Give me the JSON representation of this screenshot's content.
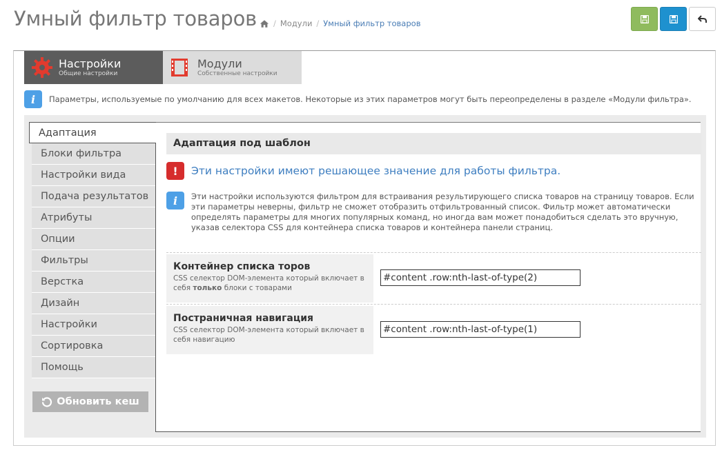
{
  "header": {
    "title": "Умный фильтр товаров",
    "breadcrumb": [
      "Модули",
      "Умный фильтр товаров"
    ]
  },
  "toolbar": {
    "save_green_icon": "floppy-icon",
    "save_blue_icon": "floppy-icon",
    "back_icon": "undo-icon"
  },
  "tabs": [
    {
      "title": "Настройки",
      "subtitle": "Общие настройки",
      "icon": "gear-icon"
    },
    {
      "title": "Модули",
      "subtitle": "Собственные настройки",
      "icon": "film-icon"
    }
  ],
  "info": "Параметры, используемые по умолчанию для всех макетов. Некоторые из этих параметров могут быть переопределены в разделе «Модули фильтра».",
  "sidebar": {
    "items": [
      "Адаптация",
      "Блоки фильтра",
      "Настройки вида",
      "Подача результатов",
      "Атрибуты",
      "Опции",
      "Фильтры",
      "Верстка",
      "Дизайн",
      "Настройки",
      "Сортировка",
      "Помощь"
    ],
    "refresh_label": "Обновить кеш"
  },
  "content": {
    "section_title": "Адаптация под шаблон",
    "warning": "Эти настройки имеют решающее значение для работы фильтра.",
    "description": "Эти настройки используются фильтром для встраивания результирующего списка товаров на страницу товаров. Если эти параметры неверны, фильтр не сможет отобразить отфильтрованный список. Фильтр может автоматически определять параметры для многих популярных команд, но иногда вам может понадобиться сделать это вручную, указав селектора CSS для контейнера списка товаров и контейнера панели страниц.",
    "fields": [
      {
        "title": "Контейнер списка торов",
        "help_pre": "CSS селектор DOM-элемента который включает в себя ",
        "help_bold": "только",
        "help_post": " блоки с товарами",
        "value": "#content .row:nth-last-of-type(2)"
      },
      {
        "title": "Постраничная навигация",
        "help_pre": "CSS селектор DOM-элемента который включает в себя навигацию",
        "help_bold": "",
        "help_post": "",
        "value": "#content .row:nth-last-of-type(1)"
      }
    ]
  },
  "colors": {
    "accent_blue": "#1e91cf",
    "green": "#8fbb5e",
    "warning_red": "#d62d2d",
    "info_blue": "#4ea0e6",
    "link_blue": "#3e7ec0"
  }
}
